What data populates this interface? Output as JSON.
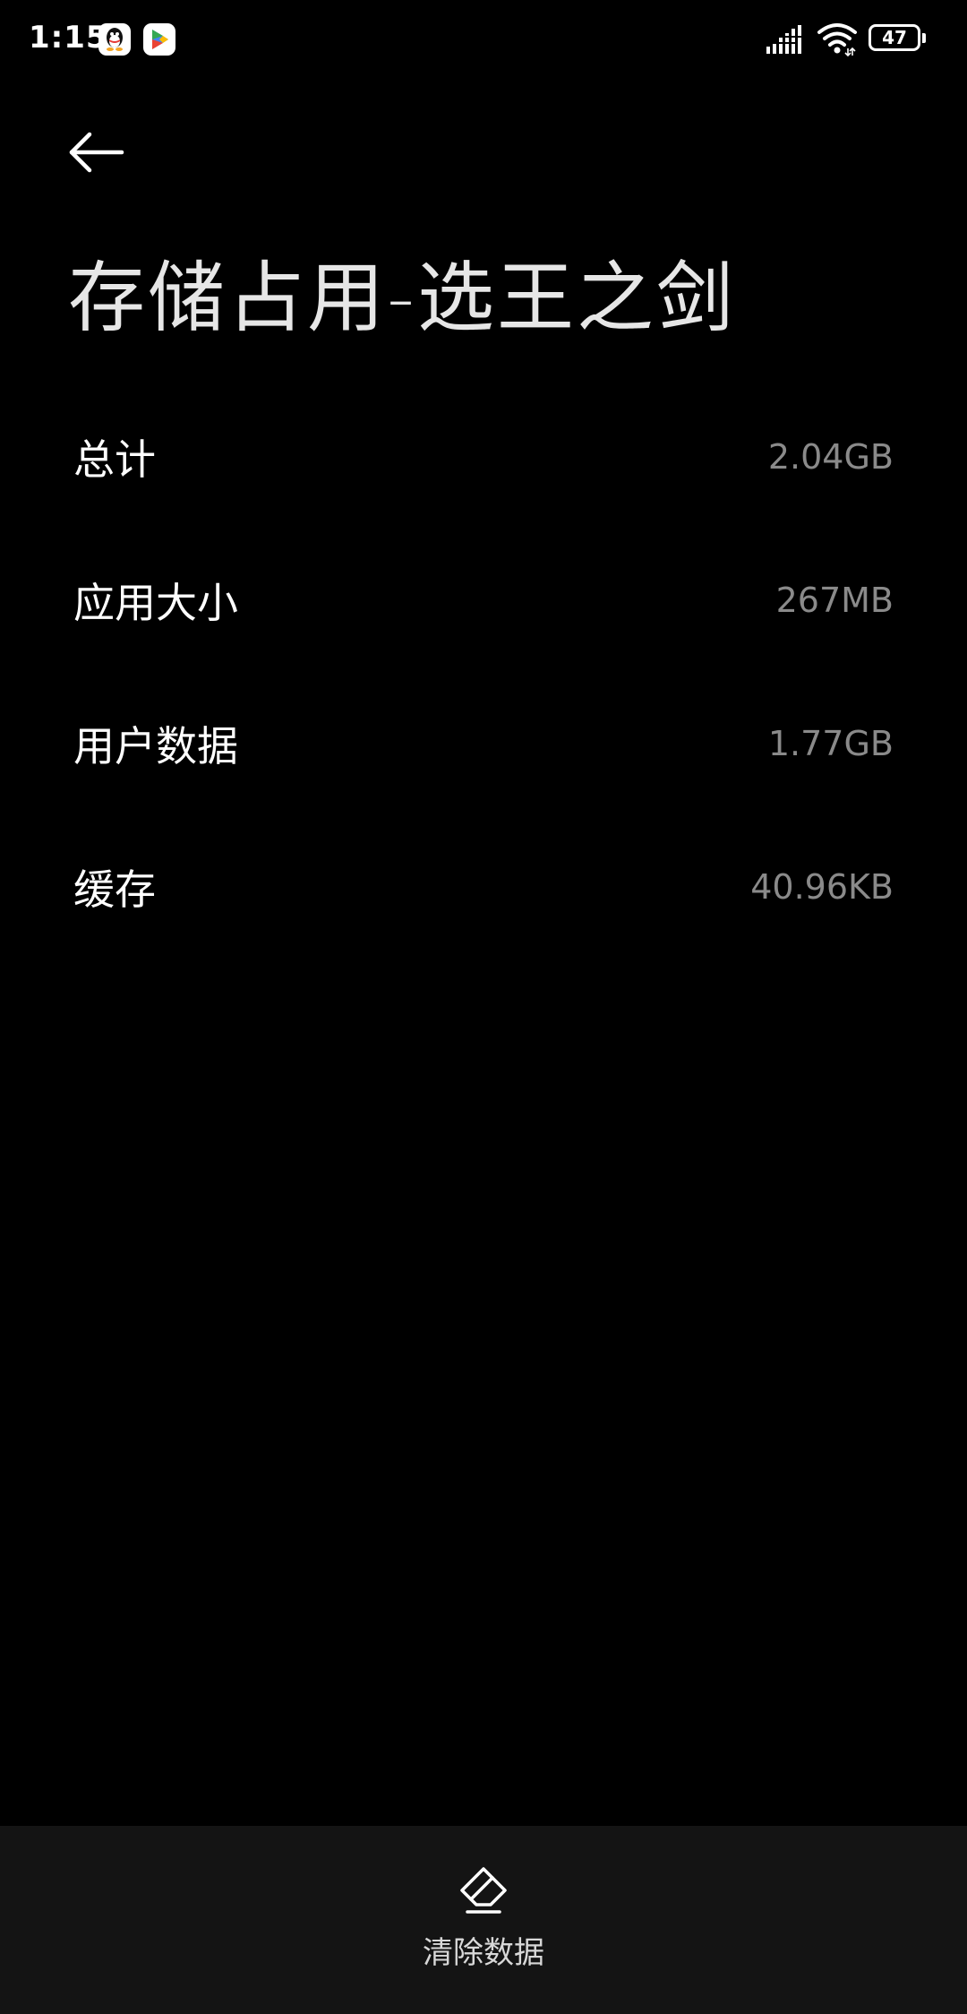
{
  "status_bar": {
    "time": "1:15",
    "battery_level": "47",
    "notification_icons": [
      "qq-icon",
      "play-store-icon"
    ],
    "indicator_icons": [
      "signal-icon",
      "wifi-icon",
      "battery-icon"
    ]
  },
  "header": {
    "back_icon": "arrow-left-icon",
    "title": "存储占用-选王之剑"
  },
  "storage": {
    "rows": [
      {
        "label": "总计",
        "value": "2.04GB"
      },
      {
        "label": "应用大小",
        "value": "267MB"
      },
      {
        "label": "用户数据",
        "value": "1.77GB"
      },
      {
        "label": "缓存",
        "value": "40.96KB"
      }
    ]
  },
  "bottom_bar": {
    "clear_icon": "eraser-icon",
    "clear_label": "清除数据"
  },
  "colors": {
    "background": "#000000",
    "bottom_bar": "#141414",
    "value_text": "#8a8a8a",
    "label_text": "#ffffff"
  }
}
